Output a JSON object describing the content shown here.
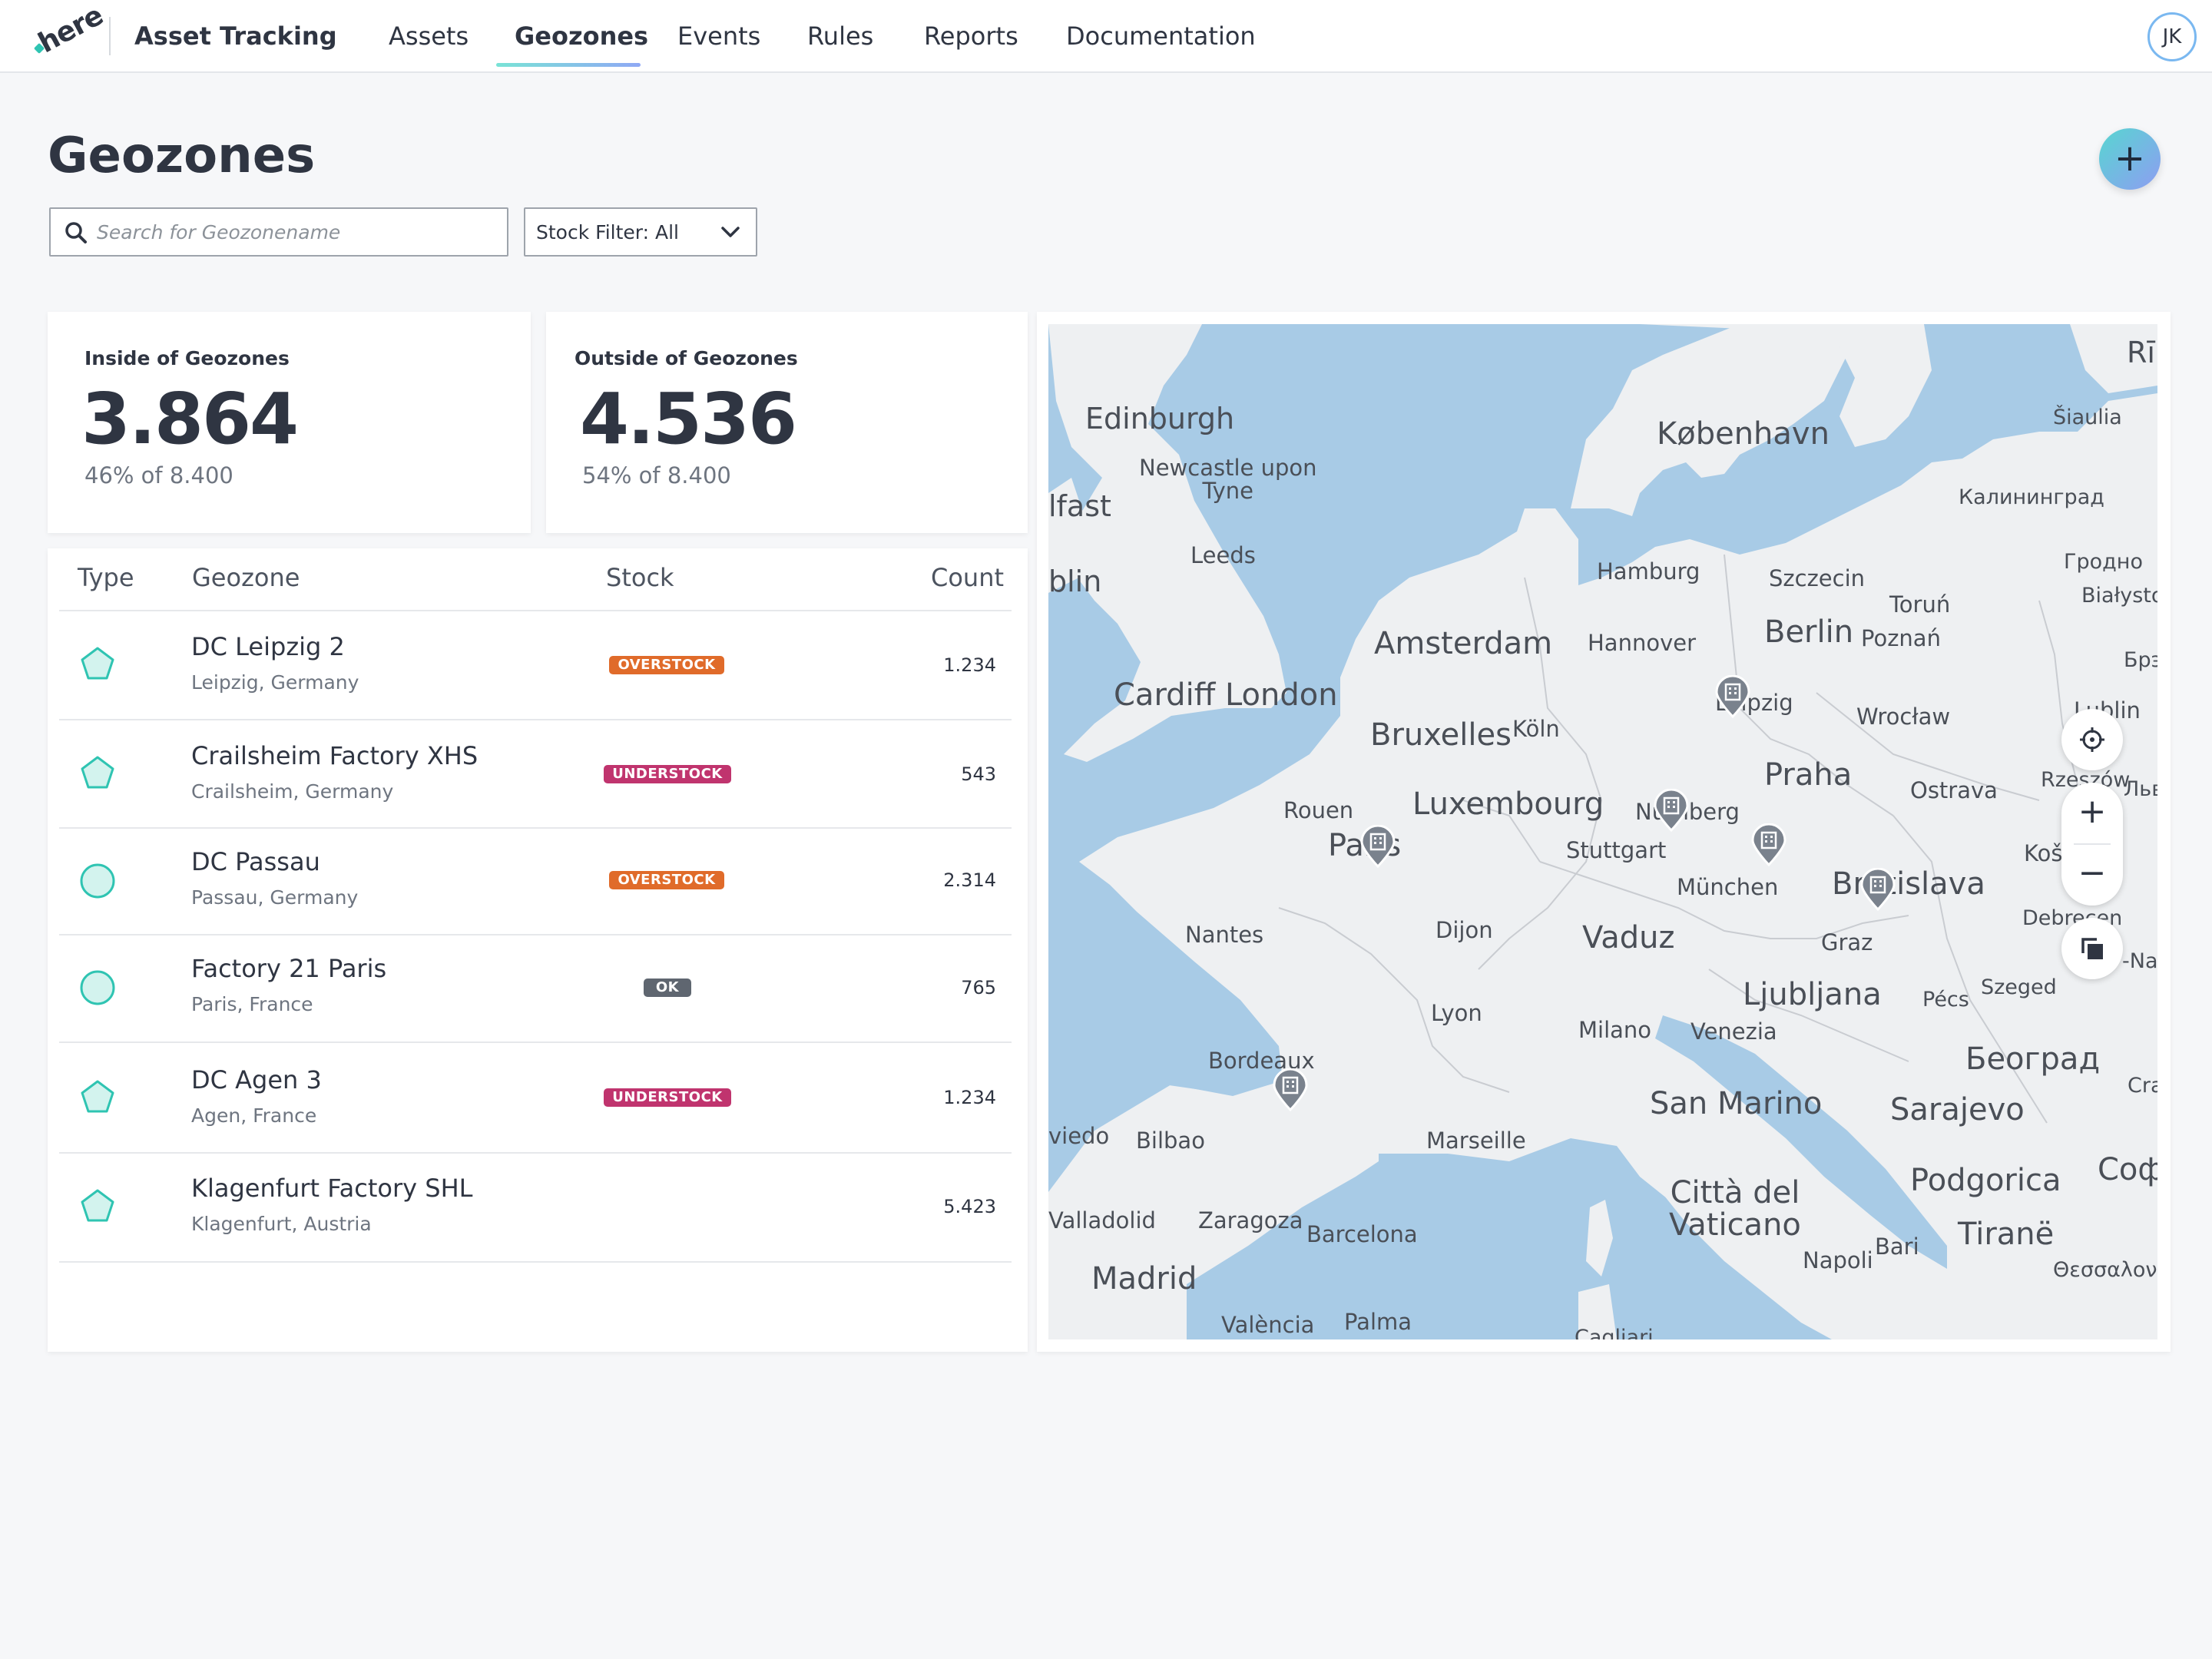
{
  "app": {
    "logo_text": "here",
    "title": "Asset Tracking"
  },
  "nav": {
    "tabs": [
      {
        "label": "Assets",
        "active": false
      },
      {
        "label": "Geozones",
        "active": true
      },
      {
        "label": "Events",
        "active": false
      },
      {
        "label": "Rules",
        "active": false
      },
      {
        "label": "Reports",
        "active": false
      },
      {
        "label": "Documentation",
        "active": false
      }
    ],
    "user_initials": "JK"
  },
  "page": {
    "title": "Geozones",
    "add_button_label": "+",
    "search": {
      "value": "",
      "placeholder": "Search for Geozonename",
      "icon": "search-icon"
    },
    "stock_filter": {
      "label": "Stock Filter: All",
      "icon": "chevron-down-icon"
    }
  },
  "kpis": [
    {
      "label": "Inside of Geozones",
      "value": "3.864",
      "sub": "46% of 8.400"
    },
    {
      "label": "Outside of Geozones",
      "value": "4.536",
      "sub": "54% of 8.400"
    }
  ],
  "table": {
    "columns": [
      "Type",
      "Geozone",
      "Stock",
      "Count"
    ],
    "rows": [
      {
        "type": "polygon",
        "name": "DC Leipzig 2",
        "location": "Leipzig, Germany",
        "stock": "OVERSTOCK",
        "count": "1.234"
      },
      {
        "type": "polygon",
        "name": "Crailsheim Factory XHS",
        "location": "Crailsheim, Germany",
        "stock": "UNDERSTOCK",
        "count": "543"
      },
      {
        "type": "circle",
        "name": "DC Passau",
        "location": "Passau, Germany",
        "stock": "OVERSTOCK",
        "count": "2.314"
      },
      {
        "type": "circle",
        "name": "Factory 21 Paris",
        "location": "Paris, France",
        "stock": "OK",
        "count": "765"
      },
      {
        "type": "polygon",
        "name": "DC Agen 3",
        "location": "Agen, France",
        "stock": "UNDERSTOCK",
        "count": "1.234"
      },
      {
        "type": "polygon",
        "name": "Klagenfurt Factory SHL",
        "location": "Klagenfurt, Austria",
        "stock": "",
        "count": "5.423"
      }
    ]
  },
  "colors": {
    "overstock": "#e06b2a",
    "understock": "#c0346e",
    "ok": "#5f6670",
    "geozone_teal": "#2fc4b2",
    "water": "#a8cbe6",
    "land": "#eef0f2"
  },
  "map": {
    "labels": {
      "edinburgh": "Edinburgh",
      "newcastle": "Newcastle upon\nTyne",
      "belfast": "lfast",
      "dublin": "blin",
      "leeds": "Leeds",
      "cardiff_london": "Cardiff London",
      "amsterdam": "Amsterdam",
      "kobenhavn": "København",
      "riga": "Rī",
      "siauliai": "Šiaulia",
      "kaliningrad": "Калининград",
      "hamburg": "Hamburg",
      "szczecin": "Szczecin",
      "torun": "Toruń",
      "grodno": "Гродно",
      "bialystok": "Białystok",
      "hannover": "Hannover",
      "berlin": "Berlin",
      "poznan": "Poznań",
      "brest": "Брэ",
      "leipzig": "Leipzig",
      "bruxelles": "Bruxelles",
      "koln": "Köln",
      "wroclaw": "Wrocław",
      "lublin": "Lublin",
      "praha": "Praha",
      "ostrava": "Ostrava",
      "rzeszow": "Rzeszów",
      "lviv": "Льв",
      "rouen": "Rouen",
      "paris": "Paris",
      "luxembourg": "Luxembourg",
      "nurnberg": "Nürnberg",
      "stuttgart": "Stuttgart",
      "kosice": "Koš",
      "munchen": "München",
      "bratislava": "Bratislava",
      "nantes": "Nantes",
      "dijon": "Dijon",
      "vaduz": "Vaduz",
      "graz": "Graz",
      "debrecen": "Debrecen",
      "napoca": "-Nap",
      "lyon": "Lyon",
      "ljubljana": "Ljubljana",
      "pecs": "Pécs",
      "szeged": "Szeged",
      "milano": "Milano",
      "venezia": "Venezia",
      "bordeaux": "Bordeaux",
      "beograd": "Београд",
      "craiova": "Craic",
      "oviedo": "viedo",
      "bilbao": "Bilbao",
      "marseille": "Marseille",
      "san_marino": "San Marino",
      "sarajevo": "Sarajevo",
      "vaticano": "Città del\nVaticano",
      "podgorica": "Podgorica",
      "sofia": "Софи",
      "valladolid": "Valladolid",
      "zaragoza": "Zaragoza",
      "barcelona": "Barcelona",
      "bari": "Bari",
      "tirane": "Tiranë",
      "napoli": "Napoli",
      "madrid": "Madrid",
      "thessaloniki": "Θεσσαλονί",
      "valencia": "València",
      "palma": "Palma",
      "cagliari": "Cagliari"
    },
    "controls": {
      "locate_icon": "crosshair-icon",
      "zoom_in": "+",
      "zoom_out": "−",
      "layers_icon": "layers-icon"
    }
  }
}
